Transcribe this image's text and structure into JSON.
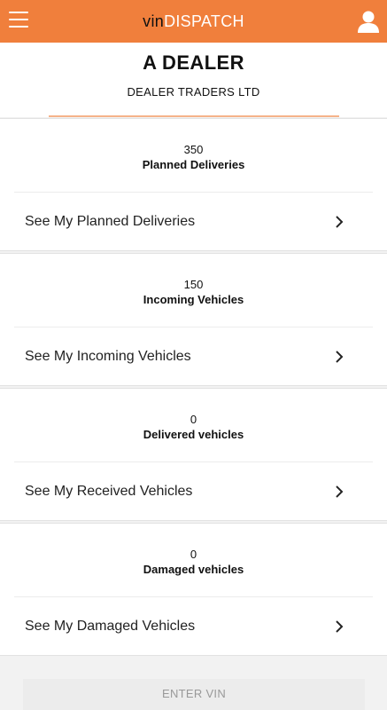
{
  "appbar": {
    "brand_prefix": "vin",
    "brand_suffix": "DISPATCH",
    "menu_icon": "hamburger-menu-icon",
    "profile_icon": "user-profile-icon",
    "color": "#f07f3c"
  },
  "header": {
    "dealer_name": "A DEALER",
    "company": "DEALER TRADERS LTD"
  },
  "cards": [
    {
      "count": "350",
      "label": "Planned Deliveries",
      "link": "See My Planned Deliveries"
    },
    {
      "count": "150",
      "label": "Incoming Vehicles",
      "link": "See My Incoming Vehicles"
    },
    {
      "count": "0",
      "label": "Delivered vehicles",
      "link": "See My Received Vehicles"
    },
    {
      "count": "0",
      "label": "Damaged vehicles",
      "link": "See My Damaged Vehicles"
    }
  ],
  "enter_vin": {
    "label": "ENTER VIN"
  }
}
